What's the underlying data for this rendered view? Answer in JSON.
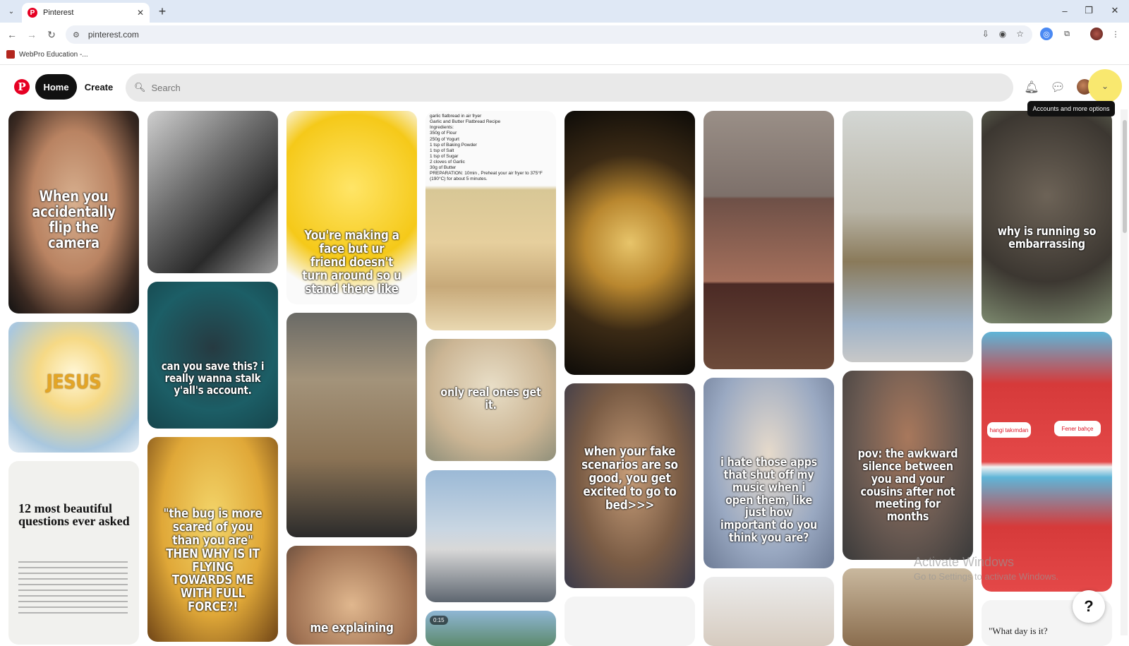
{
  "browser": {
    "tab_title": "Pinterest",
    "tab_close": "✕",
    "new_tab": "+",
    "url": "pinterest.com",
    "bookmark": "WebPro Education -..."
  },
  "header": {
    "logo": "P",
    "home_label": "Home",
    "create_label": "Create",
    "search_placeholder": "Search",
    "tooltip": "Accounts and more options",
    "notifications_icon": "bell-icon",
    "messages_icon": "chat-icon"
  },
  "pins": [
    {
      "caption": "When you accidentally flip the camera"
    },
    {
      "caption": ""
    },
    {
      "caption": "You're making a face but ur friend doesn't turn around so u stand there like"
    },
    {
      "recipe": "garlic flatbread in air fryer\nGarlic and Butter Flatbread Recipe\nIngredients:\n350g of Flour\n250g of Yogurt\n1 tsp of Baking Powder\n1 tsp of Salt\n1 tsp of Sugar\n2 cloves of Garlic\n30g of Butter\nPREPARATION: 10min , Preheat your air fryer to 375°F (190°C) for about 5 minutes."
    },
    {
      "caption": ""
    },
    {
      "caption": ""
    },
    {
      "caption": ""
    },
    {
      "caption": "why is running so embarrassing"
    },
    {
      "caption": "JESUS"
    },
    {
      "caption": "can you save this? i really wanna stalk y'all's account."
    },
    {
      "caption": ""
    },
    {
      "caption": "only real ones get it."
    },
    {
      "caption": "when your fake scenarios are so good, you get excited to go to bed>>>"
    },
    {
      "caption": "i hate those apps that shut off my music when i open them, like just how important do you think you are?"
    },
    {
      "caption": "pov: the awkward silence between you and your cousins after not meeting for months"
    },
    {
      "speech_left": "hangi takımdan",
      "speech_right": "Fener bahçe"
    },
    {
      "title": "12 most beautiful questions ever asked"
    },
    {
      "caption": "\"the bug is more scared of you than you are\" THEN WHY IS IT FLYING TOWARDS ME WITH FULL FORCE?!"
    },
    {
      "caption": "me explaining"
    },
    {
      "duration": "0:15"
    },
    {
      "quote": "\"What day is it?"
    }
  ],
  "watermark": {
    "line1": "Activate Windows",
    "line2": "Go to Settings to activate Windows."
  },
  "help": "?"
}
